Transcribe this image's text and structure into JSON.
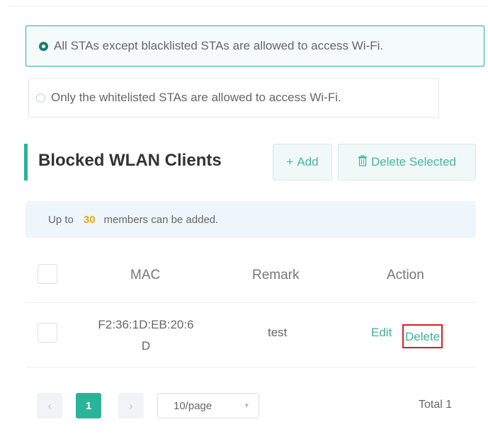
{
  "access_mode": {
    "options": [
      {
        "label": "All STAs except blacklisted STAs are allowed to access Wi-Fi.",
        "selected": true
      },
      {
        "label": "Only the whitelisted STAs are allowed to access Wi-Fi.",
        "selected": false
      }
    ]
  },
  "section": {
    "title": "Blocked WLAN Clients",
    "add_label": "Add",
    "add_icon": "plus-icon",
    "delete_selected_label": "Delete Selected",
    "delete_icon": "trash-icon"
  },
  "info": {
    "prefix": "Up to",
    "max_members": "30",
    "suffix": "members can be added."
  },
  "table": {
    "columns": [
      "MAC",
      "Remark",
      "Action"
    ],
    "rows": [
      {
        "mac_line1": "F2:36:1D:EB:20:6",
        "mac_line2": "D",
        "remark": "test",
        "edit_label": "Edit",
        "delete_label": "Delete"
      }
    ]
  },
  "pagination": {
    "prev": "‹",
    "current_page": "1",
    "next": "›",
    "page_size": "10/page",
    "total": "Total 1"
  },
  "colors": {
    "accent": "#2bb39a",
    "highlight_number": "#e6a817",
    "delete_outline": "#d62020"
  }
}
